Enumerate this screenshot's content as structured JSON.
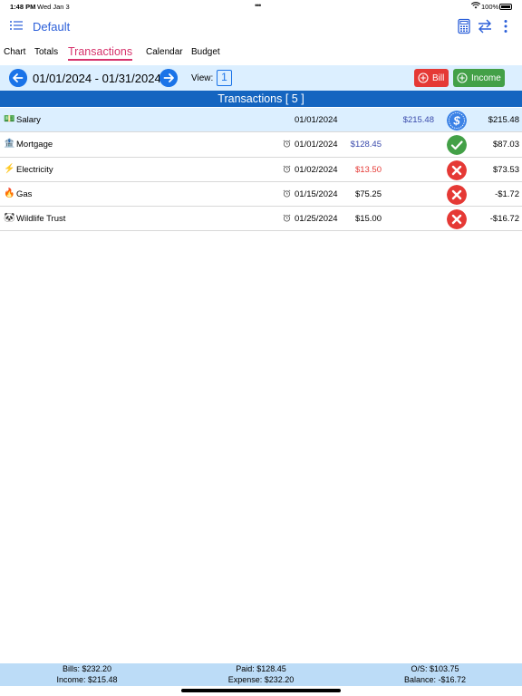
{
  "status_bar": {
    "time": "1:48 PM",
    "date": "Wed Jan 3",
    "battery": "100%"
  },
  "nav": {
    "title": "Default"
  },
  "tabs": [
    {
      "label": "Chart"
    },
    {
      "label": "Totals"
    },
    {
      "label": "Transactions"
    },
    {
      "label": "Calendar"
    },
    {
      "label": "Budget"
    }
  ],
  "active_tab": "Transactions",
  "range": {
    "text": "01/01/2024 - 01/31/2024",
    "view_label": "View:",
    "view_value": "1"
  },
  "buttons": {
    "bill": "Bill",
    "income": "Income"
  },
  "section": {
    "title": "Transactions [ 5 ]"
  },
  "transactions": [
    {
      "emoji": "💵",
      "name": "Salary",
      "date": "01/01/2024",
      "paid": "",
      "income": "$215.48",
      "status": "income",
      "balance": "$215.48",
      "alarm": false
    },
    {
      "emoji": "🏦",
      "name": "Mortgage",
      "date": "01/01/2024",
      "paid": "$128.45",
      "income": "",
      "status": "paid",
      "balance": "$87.03",
      "alarm": true
    },
    {
      "emoji": "⚡",
      "name": "Electricity",
      "date": "01/02/2024",
      "paid": "$13.50",
      "income": "",
      "status": "unpaid",
      "balance": "$73.53",
      "alarm": true
    },
    {
      "emoji": "🔥",
      "name": "Gas",
      "date": "01/15/2024",
      "paid": "$75.25",
      "income": "",
      "status": "unpaid",
      "balance": "-$1.72",
      "alarm": true
    },
    {
      "emoji": "🐼",
      "name": "Wildlife Trust",
      "date": "01/25/2024",
      "paid": "$15.00",
      "income": "",
      "status": "unpaid",
      "balance": "-$16.72",
      "alarm": true
    }
  ],
  "footer": {
    "bills": "Bills: $232.20",
    "paid": "Paid: $128.45",
    "os": "O/S: $103.75",
    "income": "Income: $215.48",
    "expense": "Expense: $232.20",
    "balance": "Balance: -$16.72"
  },
  "colors": {
    "accent": "#1a73e8",
    "active_tab": "#d6336c",
    "header": "#1565c0",
    "paid_green": "#43a047",
    "unpaid_red": "#e53935"
  }
}
